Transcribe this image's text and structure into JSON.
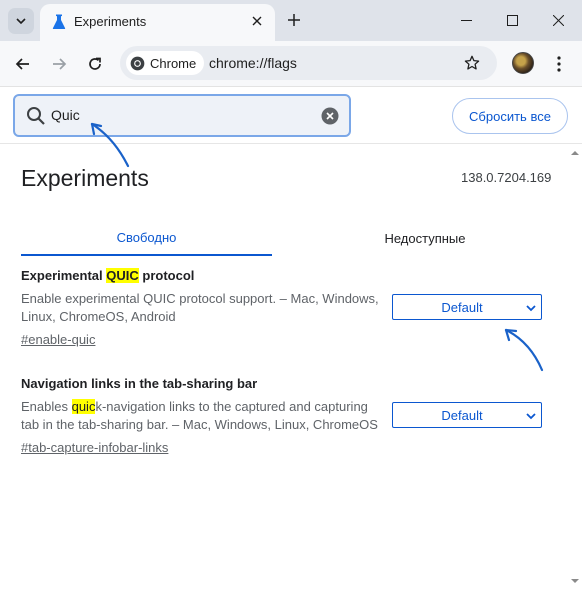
{
  "window": {
    "tab_title": "Experiments"
  },
  "toolbar": {
    "chip_label": "Chrome",
    "url": "chrome://flags"
  },
  "flags_page": {
    "search_value": "Quic",
    "reset_label": "Сбросить все",
    "title": "Experiments",
    "version": "138.0.7204.169",
    "tabs": [
      {
        "label": "Свободно",
        "selected": true
      },
      {
        "label": "Недоступные",
        "selected": false
      }
    ],
    "flags": [
      {
        "title_before": "Experimental ",
        "title_highlight": "QUIC",
        "title_after": " protocol",
        "desc_before": "Enable experimental QUIC protocol support. – Mac, Windows, Linux, ChromeOS, Android",
        "desc_highlight": "",
        "desc_after": "",
        "link": "#enable-quic",
        "select_value": "Default"
      },
      {
        "title_before": "Navigation links in the tab-sharing bar",
        "title_highlight": "",
        "title_after": "",
        "desc_before": "Enables ",
        "desc_highlight": "quic",
        "desc_after": "k-navigation links to the captured and capturing tab in the tab-sharing bar. – Mac, Windows, Linux, ChromeOS",
        "link": "#tab-capture-infobar-links",
        "select_value": "Default"
      }
    ]
  },
  "colors": {
    "accent": "#0b57d0",
    "highlight": "#ffff00",
    "annotation_arrow": "#1a62c9"
  }
}
